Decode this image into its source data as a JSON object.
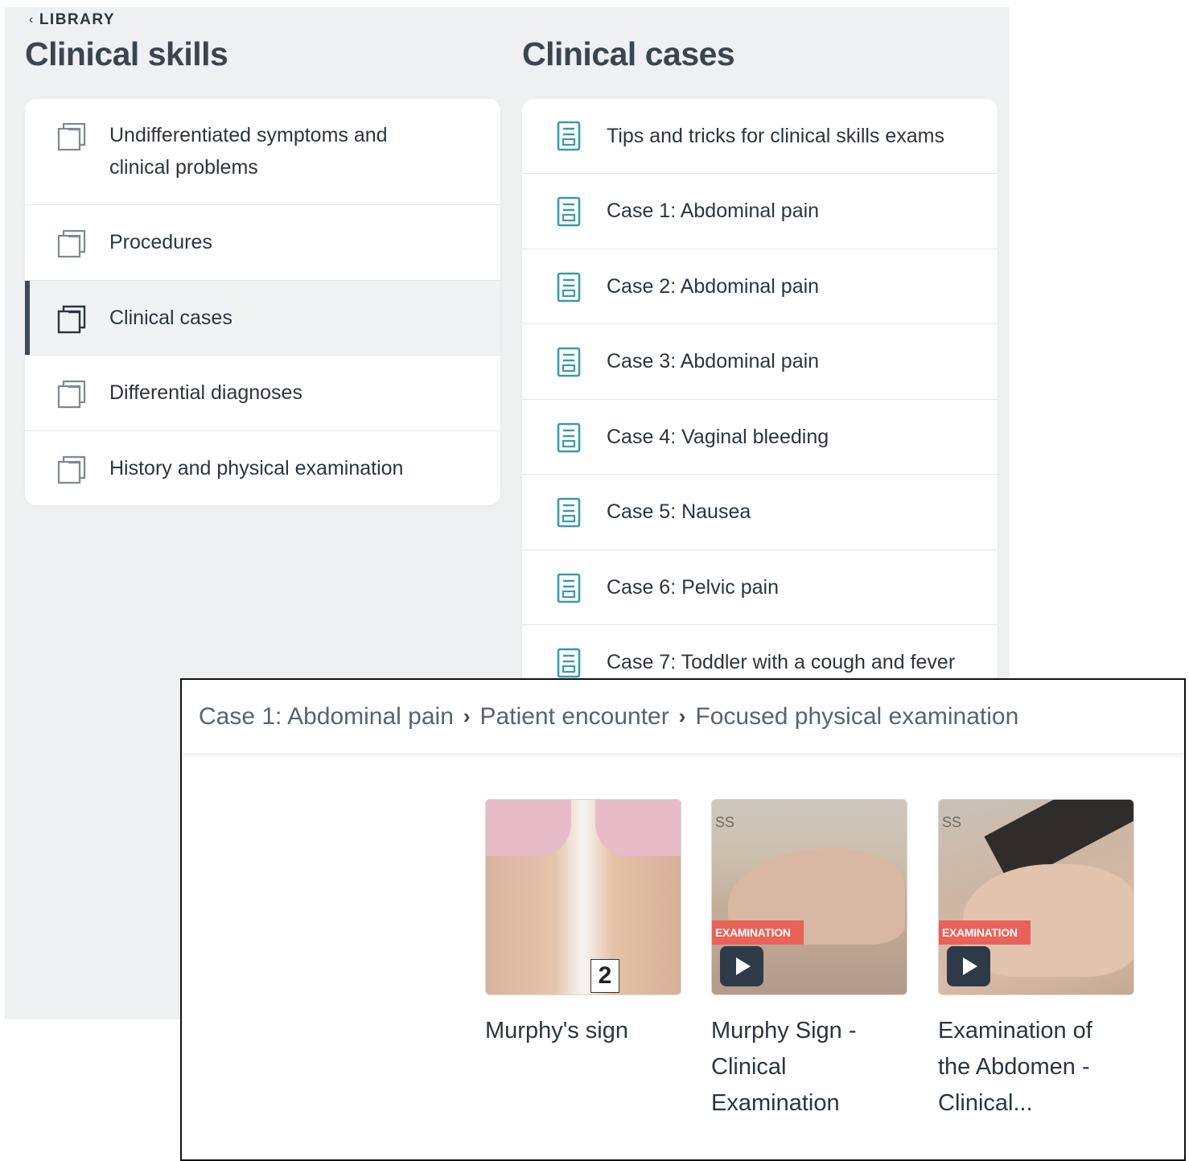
{
  "back_link": {
    "chevron": "‹",
    "label": "LIBRARY"
  },
  "clinical_skills": {
    "title": "Clinical skills",
    "items": [
      {
        "label": "Undifferentiated symptoms and clinical problems",
        "icon": "stack-icon",
        "active": false
      },
      {
        "label": "Procedures",
        "icon": "stack-icon",
        "active": false
      },
      {
        "label": "Clinical cases",
        "icon": "stack-icon",
        "active": true
      },
      {
        "label": "Differential diagnoses",
        "icon": "stack-icon",
        "active": false
      },
      {
        "label": "History and physical examination",
        "icon": "stack-icon",
        "active": false
      }
    ]
  },
  "clinical_cases": {
    "title": "Clinical cases",
    "items": [
      {
        "label": "Tips and tricks for clinical skills exams",
        "icon": "document-icon"
      },
      {
        "label": "Case 1: Abdominal pain",
        "icon": "document-icon"
      },
      {
        "label": "Case 2: Abdominal pain",
        "icon": "document-icon"
      },
      {
        "label": "Case 3: Abdominal pain",
        "icon": "document-icon"
      },
      {
        "label": "Case 4: Vaginal bleeding",
        "icon": "document-icon"
      },
      {
        "label": "Case 5: Nausea",
        "icon": "document-icon"
      },
      {
        "label": "Case 6: Pelvic pain",
        "icon": "document-icon"
      },
      {
        "label": "Case 7: Toddler with a cough and fever",
        "icon": "document-icon"
      }
    ]
  },
  "overlay": {
    "breadcrumb": [
      "Case 1: Abdominal pain",
      "Patient encounter",
      "Focused physical examination"
    ],
    "breadcrumb_separator": "›",
    "tiles": [
      {
        "title_lines": [
          "Murphy's sign"
        ],
        "is_video": false,
        "badge": "2"
      },
      {
        "title_lines": [
          "Murphy Sign -",
          "Clinical",
          "Examination"
        ],
        "is_video": true,
        "banner": "EXAMINATION",
        "watermark": "SS"
      },
      {
        "title_lines": [
          "Examination of",
          "the Abdomen -",
          "Clinical..."
        ],
        "is_video": true,
        "banner": "EXAMINATION",
        "watermark": "SS"
      }
    ]
  },
  "colors": {
    "panel_bg": "#eef0f2",
    "accent_teal": "#3a9aa8",
    "active_bar": "#3f4a57",
    "exam_banner": "#e8625a"
  }
}
